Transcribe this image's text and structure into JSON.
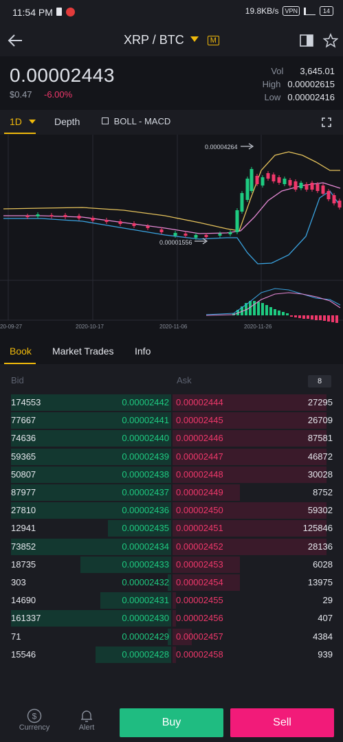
{
  "status_bar": {
    "time": "11:54 PM",
    "network_speed": "19.8KB/s",
    "vpn": "VPN",
    "battery": "14"
  },
  "header": {
    "pair": "XRP / BTC",
    "margin_badge": "M"
  },
  "ticker": {
    "price": "0.00002443",
    "fiat": "$0.47",
    "change": "-6.00%",
    "vol_label": "Vol",
    "vol": "3,645.01",
    "high_label": "High",
    "high": "0.00002615",
    "low_label": "Low",
    "low": "0.00002416"
  },
  "chart_tabs": {
    "interval": "1D",
    "depth": "Depth",
    "indicators": "BOLL - MACD"
  },
  "chart_data": {
    "type": "line",
    "x_tick_labels": [
      "20-09-27",
      "2020-10-17",
      "2020-11-06",
      "2020-11-26"
    ],
    "annotations": {
      "max": "0.00004264",
      "min": "0.00001556"
    },
    "max": 4.264e-05,
    "min": 1.556e-05,
    "grid": true
  },
  "book_tabs": {
    "book": "Book",
    "trades": "Market Trades",
    "info": "Info"
  },
  "order_book": {
    "bid_label": "Bid",
    "ask_label": "Ask",
    "depth_setting": "8",
    "rows": [
      {
        "bid_qty": "174553",
        "bid_price": "0.00002442",
        "bid_fill": 0.99,
        "ask_price": "0.00002444",
        "ask_qty": "27295",
        "ask_fill": 0.96
      },
      {
        "bid_qty": "77667",
        "bid_price": "0.00002441",
        "bid_fill": 0.99,
        "ask_price": "0.00002445",
        "ask_qty": "26709",
        "ask_fill": 0.96
      },
      {
        "bid_qty": "74636",
        "bid_price": "0.00002440",
        "bid_fill": 0.99,
        "ask_price": "0.00002446",
        "ask_qty": "87581",
        "ask_fill": 0.96
      },
      {
        "bid_qty": "59365",
        "bid_price": "0.00002439",
        "bid_fill": 0.99,
        "ask_price": "0.00002447",
        "ask_qty": "46872",
        "ask_fill": 0.96
      },
      {
        "bid_qty": "50807",
        "bid_price": "0.00002438",
        "bid_fill": 0.99,
        "ask_price": "0.00002448",
        "ask_qty": "30028",
        "ask_fill": 0.96
      },
      {
        "bid_qty": "87977",
        "bid_price": "0.00002437",
        "bid_fill": 0.99,
        "ask_price": "0.00002449",
        "ask_qty": "8752",
        "ask_fill": 0.42
      },
      {
        "bid_qty": "27810",
        "bid_price": "0.00002436",
        "bid_fill": 0.99,
        "ask_price": "0.00002450",
        "ask_qty": "59302",
        "ask_fill": 0.96
      },
      {
        "bid_qty": "12941",
        "bid_price": "0.00002435",
        "bid_fill": 0.39,
        "ask_price": "0.00002451",
        "ask_qty": "125846",
        "ask_fill": 0.96
      },
      {
        "bid_qty": "73852",
        "bid_price": "0.00002434",
        "bid_fill": 0.99,
        "ask_price": "0.00002452",
        "ask_qty": "28136",
        "ask_fill": 0.96
      },
      {
        "bid_qty": "18735",
        "bid_price": "0.00002433",
        "bid_fill": 0.56,
        "ask_price": "0.00002453",
        "ask_qty": "6028",
        "ask_fill": 0.42
      },
      {
        "bid_qty": "303",
        "bid_price": "0.00002432",
        "bid_fill": 0.02,
        "ask_price": "0.00002454",
        "ask_qty": "13975",
        "ask_fill": 0.42
      },
      {
        "bid_qty": "14690",
        "bid_price": "0.00002431",
        "bid_fill": 0.44,
        "ask_price": "0.00002455",
        "ask_qty": "29",
        "ask_fill": 0.02
      },
      {
        "bid_qty": "161337",
        "bid_price": "0.00002430",
        "bid_fill": 0.99,
        "ask_price": "0.00002456",
        "ask_qty": "407",
        "ask_fill": 0.02
      },
      {
        "bid_qty": "71",
        "bid_price": "0.00002429",
        "bid_fill": 0.02,
        "ask_price": "0.00002457",
        "ask_qty": "4384",
        "ask_fill": 0.12
      },
      {
        "bid_qty": "15546",
        "bid_price": "0.00002428",
        "bid_fill": 0.47,
        "ask_price": "0.00002458",
        "ask_qty": "939",
        "ask_fill": 0.02
      }
    ]
  },
  "footer": {
    "currency": "Currency",
    "alert": "Alert",
    "buy": "Buy",
    "sell": "Sell"
  },
  "colors": {
    "accent": "#f0b90b",
    "up": "#1ecb81",
    "down": "#f0386b",
    "buy": "#1fbc81",
    "sell": "#f21b79"
  }
}
